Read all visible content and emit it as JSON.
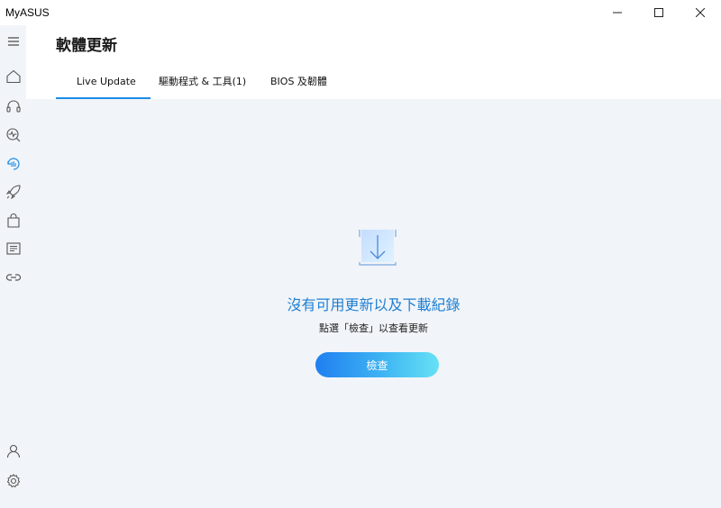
{
  "window": {
    "title": "MyASUS",
    "controls": [
      "minimize-icon",
      "maximize-icon",
      "close-icon"
    ]
  },
  "sidebar": {
    "top_items": [
      {
        "icon": "hamburger-menu-icon"
      },
      {
        "icon": "home-icon"
      },
      {
        "icon": "headset-icon"
      },
      {
        "icon": "diagnosis-icon"
      },
      {
        "icon": "system-update-icon",
        "active": true
      },
      {
        "icon": "rocket-icon"
      },
      {
        "icon": "shopping-bag-icon"
      },
      {
        "icon": "news-icon"
      },
      {
        "icon": "link-icon"
      }
    ],
    "bottom_items": [
      {
        "icon": "user-icon"
      },
      {
        "icon": "settings-icon"
      }
    ],
    "active_color": "#1d8ce8"
  },
  "header": {
    "title": "軟體更新",
    "tabs": [
      {
        "label": "Live Update",
        "active": true
      },
      {
        "label": "驅動程式 & 工具(1)",
        "active": false
      },
      {
        "label": "BIOS 及韌體",
        "active": false
      }
    ]
  },
  "main": {
    "empty_icon": "download-icon",
    "empty_title": "沒有可用更新以及下載紀錄",
    "empty_subtitle": "點選「檢查」以查看更新",
    "check_button_label": "檢查"
  },
  "colors": {
    "accent": "#1d8ce8",
    "background": "#f1f4f8"
  }
}
